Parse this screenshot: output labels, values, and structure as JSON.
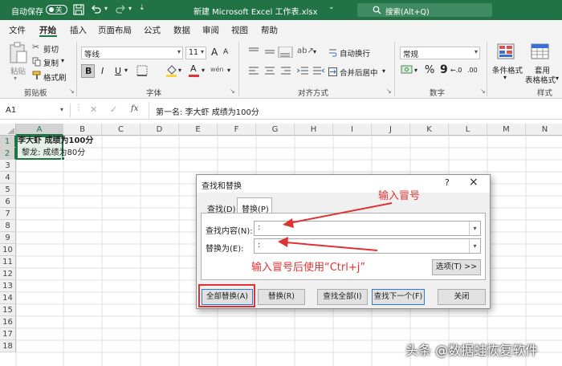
{
  "titlebar": {
    "autosave_label": "自动保存",
    "autosave_state": "关",
    "doc_title": "新建 Microsoft Excel 工作表.xlsx",
    "search_placeholder": "搜索(Alt+Q)"
  },
  "menu": {
    "items": [
      "文件",
      "开始",
      "插入",
      "页面布局",
      "公式",
      "数据",
      "审阅",
      "视图",
      "帮助"
    ],
    "active_index": 1
  },
  "ribbon": {
    "clipboard": {
      "paste": "粘贴",
      "cut": "剪切",
      "copy": "复制",
      "format_painter": "格式刷",
      "group": "剪贴板"
    },
    "font": {
      "font_name": "等线",
      "font_size": "11",
      "grow": "A",
      "shrink": "A",
      "bold": "B",
      "italic": "I",
      "underline": "U",
      "underline_menu": "▾",
      "fill_menu": "▾",
      "font_color_glyph": "A",
      "font_color_menu": "▾",
      "phonetic": "wén",
      "phonetic_menu": "▾",
      "group": "字体"
    },
    "alignment": {
      "wrap": "自动换行",
      "merge": "合并后居中",
      "merge_menu": "▾",
      "group": "对齐方式"
    },
    "number": {
      "format": "常规",
      "percent": "%",
      "comma": "9",
      "inc_decimal": "←.0",
      "dec_decimal": ".00",
      "group": "数字"
    },
    "styles": {
      "conditional": "条件格式",
      "conditional_menu": "▾",
      "table": "套用",
      "table2": "表格格式",
      "table_menu": "▾",
      "group": "样式"
    },
    "accent": "#217346"
  },
  "formula_bar": {
    "name_box": "A1",
    "fx": "fx",
    "content": "第一名:  李大虾   成绩为100分"
  },
  "grid": {
    "columns": [
      "A",
      "B",
      "C",
      "D",
      "E",
      "F",
      "G",
      "H",
      "I",
      "J",
      "K",
      "L",
      "M",
      "N"
    ],
    "rows": [
      "1",
      "2",
      "3",
      "4",
      "5",
      "6",
      "7",
      "8",
      "9",
      "10",
      "11",
      "12",
      "13",
      "14",
      "15",
      "16",
      "17",
      "18"
    ],
    "cells": {
      "a1": "李大虾   成绩为100分",
      "a2": "黎龙:  成绩为80分"
    }
  },
  "dialog": {
    "title": "查找和替换",
    "help": "?",
    "close": "×",
    "tabs": [
      "查找(D)",
      "替换(P)"
    ],
    "active_tab": 1,
    "find_label": "查找内容(N):",
    "find_value": ":",
    "replace_label": "替换为(E):",
    "replace_value": ":",
    "options_button": "选项(T) >>",
    "buttons": [
      "全部替换(A)",
      "替换(R)",
      "查找全部(I)",
      "查找下一个(F)",
      "关闭"
    ]
  },
  "annotations": {
    "colon_note": "输入冒号",
    "ctrlj_note": "输入冒号后使用“Ctrl+j”",
    "color": "#e03232"
  },
  "watermark": "头条 @数据蛙恢复软件"
}
